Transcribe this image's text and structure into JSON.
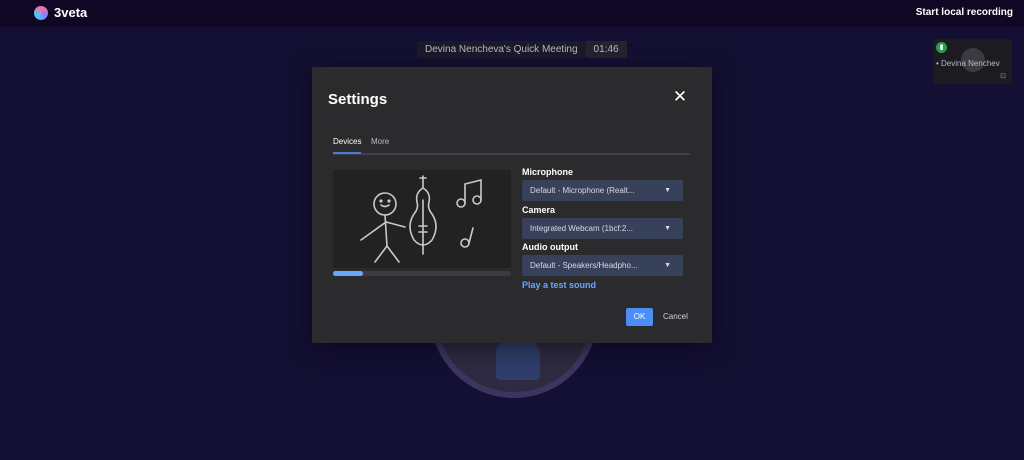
{
  "app": {
    "name": "3veta",
    "record_label": "Start local recording"
  },
  "meeting": {
    "title": "Devina Nencheva's Quick Meeting",
    "time": "01:46"
  },
  "participant": {
    "name": "Devina Nenchev"
  },
  "icons": {
    "logo": "logo-icon",
    "close": "close-icon",
    "chevron": "chevron-down-icon",
    "signal": "signal-icon",
    "camera_off": "camera-icon"
  },
  "settings": {
    "title": "Settings",
    "close_symbol": "✕",
    "tabs": [
      {
        "label": "Devices",
        "active": true
      },
      {
        "label": "More",
        "active": false
      }
    ],
    "mic_level": 0.17,
    "microphone": {
      "label": "Microphone",
      "value": "Default - Microphone (Realt..."
    },
    "camera": {
      "label": "Camera",
      "value": "Integrated Webcam (1bcf:2..."
    },
    "audio_output": {
      "label": "Audio output",
      "value": "Default - Speakers/Headpho..."
    },
    "test_sound": "Play a test sound",
    "ok": "OK",
    "cancel": "Cancel"
  },
  "colors": {
    "accent": "#4c8ef7",
    "link": "#6aa6ff",
    "background": "#141033",
    "topbar": "#100724"
  }
}
